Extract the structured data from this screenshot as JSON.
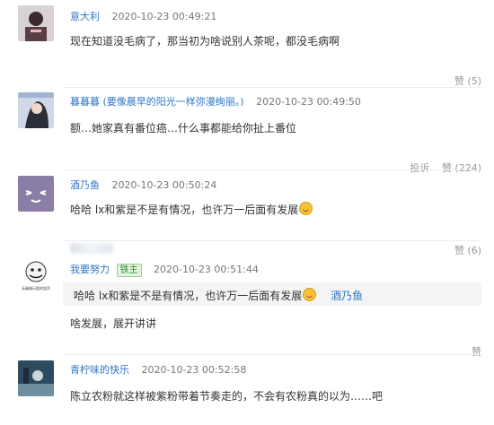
{
  "comments": [
    {
      "username": "意大利",
      "time": "2020-10-23 00:49:21",
      "text": "现在知道没毛病了，那当初为啥说别人茶呢，都没毛病啊",
      "footer": "赞 (5)"
    },
    {
      "username": "暮暮暮",
      "username_note": "(要像晨早的阳光一样弥漫绚丽。)",
      "time": "2020-10-23 00:49:50",
      "text": "额…她家真有番位癌…什么事都能给你扯上番位",
      "footer_report": "投诉",
      "footer": "赞 (224)"
    },
    {
      "username": "酒乃鱼",
      "time": "2020-10-23 00:50:24",
      "text": "哈哈 lx和紫是不是有情况，也许万一后面有发展",
      "footer": "赞 (6)"
    },
    {
      "username": "我要努力",
      "badge": "铁主",
      "time": "2020-10-23 00:51:44",
      "quote_text": "哈哈 lx和紫是不是有情况，也许万一后面有发展",
      "quote_author": "酒乃鱼",
      "text": "啥发展，展开讲讲",
      "avatar_caption": "无敌暗示姐的笑声",
      "footer": "赞"
    },
    {
      "username": "青柠味的快乐",
      "time": "2020-10-23 00:52:58",
      "text": "陈立农粉就这样被紫粉带着节奏走的，不会有农粉真的以为……吧"
    }
  ],
  "colors": {
    "link": "#2f76c6",
    "muted": "#999999",
    "text": "#333333"
  }
}
